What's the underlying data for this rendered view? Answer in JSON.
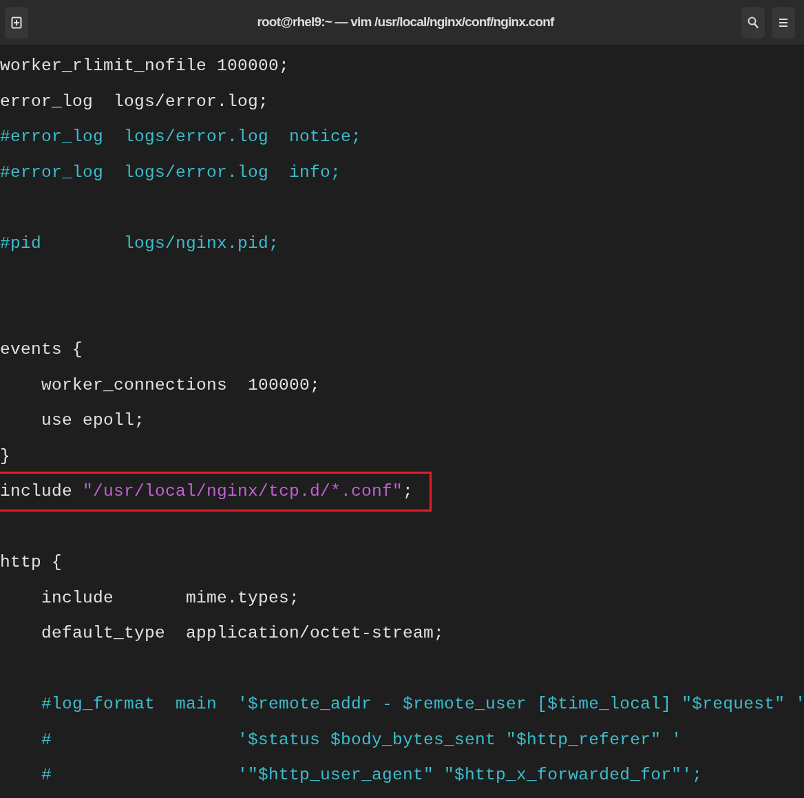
{
  "window": {
    "title": "root@rhel9:~ — vim /usr/local/nginx/conf/nginx.conf"
  },
  "lines": [
    {
      "kind": "code",
      "highlighted": false,
      "segments": [
        {
          "kind": "plain",
          "text": "worker_rlimit_nofile 100000;"
        }
      ]
    },
    {
      "kind": "code",
      "highlighted": false,
      "segments": [
        {
          "kind": "plain",
          "text": "error_log  logs/error.log;"
        }
      ]
    },
    {
      "kind": "code",
      "highlighted": false,
      "segments": [
        {
          "kind": "comment",
          "text": "#error_log  logs/error.log  notice;"
        }
      ]
    },
    {
      "kind": "code",
      "highlighted": false,
      "segments": [
        {
          "kind": "comment",
          "text": "#error_log  logs/error.log  info;"
        }
      ]
    },
    {
      "kind": "blank"
    },
    {
      "kind": "code",
      "highlighted": false,
      "segments": [
        {
          "kind": "comment",
          "text": "#pid        logs/nginx.pid;"
        }
      ]
    },
    {
      "kind": "blank"
    },
    {
      "kind": "blank"
    },
    {
      "kind": "code",
      "highlighted": false,
      "segments": [
        {
          "kind": "plain",
          "text": "events {"
        }
      ]
    },
    {
      "kind": "code",
      "highlighted": false,
      "segments": [
        {
          "kind": "plain",
          "text": "    worker_connections  100000;"
        }
      ]
    },
    {
      "kind": "code",
      "highlighted": false,
      "segments": [
        {
          "kind": "plain",
          "text": "    use epoll;"
        }
      ]
    },
    {
      "kind": "code",
      "highlighted": false,
      "segments": [
        {
          "kind": "plain",
          "text": "}"
        }
      ]
    },
    {
      "kind": "code",
      "highlighted": true,
      "segments": [
        {
          "kind": "plain",
          "text": "include "
        },
        {
          "kind": "string",
          "text": "\"/usr/local/nginx/tcp.d/*.conf\""
        },
        {
          "kind": "plain",
          "text": ";"
        }
      ]
    },
    {
      "kind": "blank"
    },
    {
      "kind": "code",
      "highlighted": false,
      "segments": [
        {
          "kind": "plain",
          "text": "http {"
        }
      ]
    },
    {
      "kind": "code",
      "highlighted": false,
      "segments": [
        {
          "kind": "plain",
          "text": "    include       mime.types;"
        }
      ]
    },
    {
      "kind": "code",
      "highlighted": false,
      "segments": [
        {
          "kind": "plain",
          "text": "    default_type  application/octet-stream;"
        }
      ]
    },
    {
      "kind": "blank"
    },
    {
      "kind": "code",
      "highlighted": false,
      "segments": [
        {
          "kind": "comment",
          "text": "    #log_format  main  '$remote_addr - $remote_user [$time_local] \"$request\" '"
        }
      ]
    },
    {
      "kind": "code",
      "highlighted": false,
      "segments": [
        {
          "kind": "comment",
          "text": "    #                  '$status $body_bytes_sent \"$http_referer\" '"
        }
      ]
    },
    {
      "kind": "code",
      "highlighted": false,
      "segments": [
        {
          "kind": "comment",
          "text": "    #                  '\"$http_user_agent\" \"$http_x_forwarded_for\"';"
        }
      ]
    }
  ]
}
